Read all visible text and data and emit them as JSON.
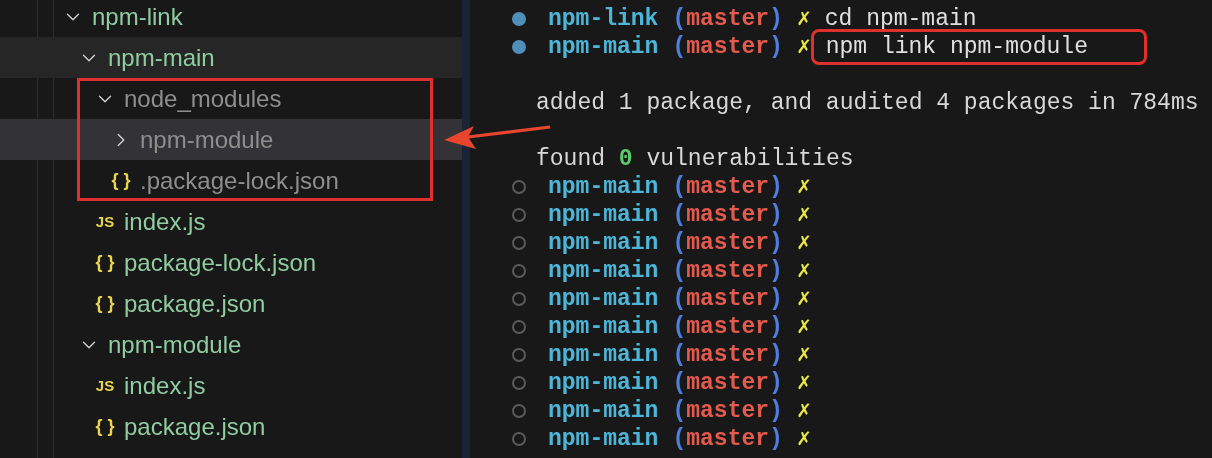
{
  "explorer": {
    "tree": [
      {
        "name": "npm-link",
        "expanded": true,
        "ignored": false,
        "selected": false,
        "hovered": false,
        "children": [
          {
            "name": "npm-main",
            "expanded": true,
            "ignored": false,
            "selected": false,
            "hovered": true,
            "children": [
              {
                "name": "node_modules",
                "expanded": true,
                "ignored": true,
                "selected": false,
                "hovered": false,
                "highlighted": true,
                "children": [
                  {
                    "name": "npm-module",
                    "expanded": false,
                    "ignored": true,
                    "selected": true,
                    "hovered": false
                  },
                  {
                    "name": ".package-lock.json",
                    "icon": "{ }",
                    "ignored": true,
                    "selected": false,
                    "hovered": false
                  }
                ]
              },
              {
                "name": "index.js",
                "icon": "JS",
                "ignored": false,
                "selected": false,
                "hovered": false
              },
              {
                "name": "package-lock.json",
                "icon": "{ }",
                "ignored": false,
                "selected": false,
                "hovered": false
              },
              {
                "name": "package.json",
                "icon": "{ }",
                "ignored": false,
                "selected": false,
                "hovered": false
              }
            ]
          },
          {
            "name": "npm-module",
            "expanded": true,
            "ignored": false,
            "selected": false,
            "hovered": false,
            "children": [
              {
                "name": "index.js",
                "icon": "JS",
                "ignored": false,
                "selected": false,
                "hovered": false
              },
              {
                "name": "package.json",
                "icon": "{ }",
                "ignored": false,
                "selected": false,
                "hovered": false
              }
            ]
          }
        ]
      }
    ]
  },
  "terminal": {
    "lines": [
      {
        "kind": "prompt",
        "done": true,
        "dir": "npm-link",
        "open": "(",
        "branch": "master",
        "close": ")",
        "dirty": "✗",
        "command": "cd npm-main",
        "highlighted": false
      },
      {
        "kind": "prompt",
        "done": true,
        "dir": "npm-main",
        "open": "(",
        "branch": "master",
        "close": ")",
        "dirty": "✗",
        "command": "npm link npm-module",
        "highlighted": true
      },
      {
        "kind": "blank"
      },
      {
        "kind": "output",
        "text": "added 1 package, and audited 4 packages in 784ms"
      },
      {
        "kind": "blank"
      },
      {
        "kind": "summary",
        "before": "found",
        "count": "0",
        "after": "vulnerabilities"
      },
      {
        "kind": "prompt",
        "done": false,
        "dir": "npm-main",
        "open": "(",
        "branch": "master",
        "close": ")",
        "dirty": "✗"
      },
      {
        "kind": "prompt",
        "done": false,
        "dir": "npm-main",
        "open": "(",
        "branch": "master",
        "close": ")",
        "dirty": "✗"
      },
      {
        "kind": "prompt",
        "done": false,
        "dir": "npm-main",
        "open": "(",
        "branch": "master",
        "close": ")",
        "dirty": "✗"
      },
      {
        "kind": "prompt",
        "done": false,
        "dir": "npm-main",
        "open": "(",
        "branch": "master",
        "close": ")",
        "dirty": "✗"
      },
      {
        "kind": "prompt",
        "done": false,
        "dir": "npm-main",
        "open": "(",
        "branch": "master",
        "close": ")",
        "dirty": "✗"
      },
      {
        "kind": "prompt",
        "done": false,
        "dir": "npm-main",
        "open": "(",
        "branch": "master",
        "close": ")",
        "dirty": "✗"
      },
      {
        "kind": "prompt",
        "done": false,
        "dir": "npm-main",
        "open": "(",
        "branch": "master",
        "close": ")",
        "dirty": "✗"
      },
      {
        "kind": "prompt",
        "done": false,
        "dir": "npm-main",
        "open": "(",
        "branch": "master",
        "close": ")",
        "dirty": "✗"
      },
      {
        "kind": "prompt",
        "done": false,
        "dir": "npm-main",
        "open": "(",
        "branch": "master",
        "close": ")",
        "dirty": "✗"
      },
      {
        "kind": "prompt",
        "done": false,
        "dir": "npm-main",
        "open": "(",
        "branch": "master",
        "close": ")",
        "dirty": "✗"
      }
    ]
  }
}
